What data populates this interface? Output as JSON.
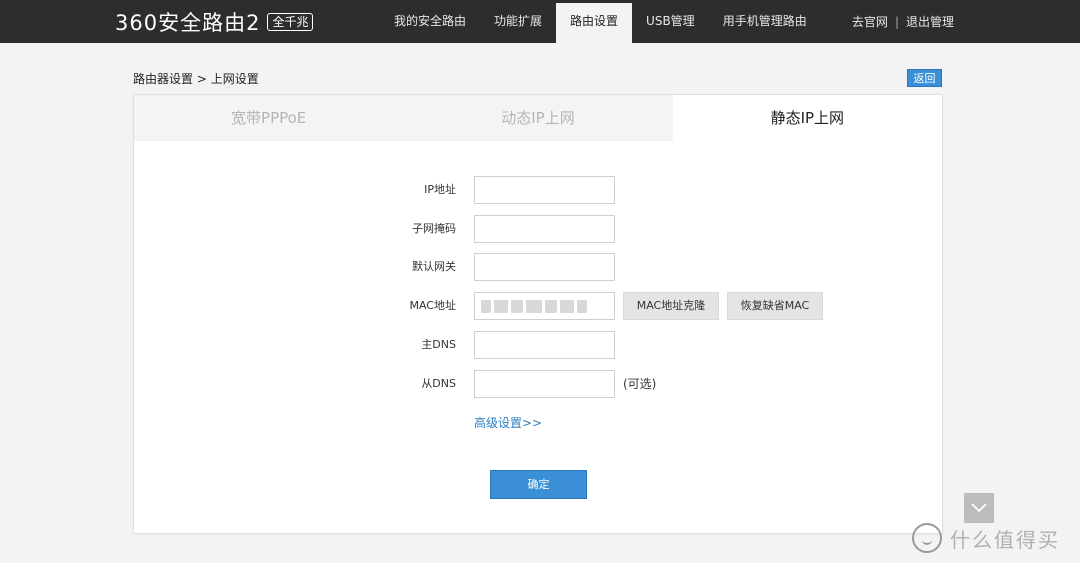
{
  "header": {
    "logo_text": "360安全路由2",
    "logo_badge": "全千兆",
    "nav": [
      {
        "label": "我的安全路由"
      },
      {
        "label": "功能扩展"
      },
      {
        "label": "路由设置"
      },
      {
        "label": "USB管理"
      },
      {
        "label": "用手机管理路由"
      }
    ],
    "active_nav": "路由设置",
    "links": {
      "official_site": "去官网",
      "logout": "退出管理"
    }
  },
  "breadcrumb": {
    "parent": "路由器设置",
    "separator": ">",
    "current": "上网设置"
  },
  "back_button": "返回",
  "tabs": [
    {
      "label": "宽带PPPoE"
    },
    {
      "label": "动态IP上网"
    },
    {
      "label": "静态IP上网"
    }
  ],
  "active_tab": "静态IP上网",
  "form": {
    "ip": {
      "label": "IP地址",
      "value": ""
    },
    "subnet": {
      "label": "子网掩码",
      "value": ""
    },
    "gateway": {
      "label": "默认网关",
      "value": ""
    },
    "mac": {
      "label": "MAC地址",
      "value": "",
      "clone_button": "MAC地址克隆",
      "restore_button": "恢复缺省MAC"
    },
    "dns1": {
      "label": "主DNS",
      "value": ""
    },
    "dns2": {
      "label": "从DNS",
      "value": "",
      "hint": "(可选)"
    },
    "advanced_link": "高级设置>>",
    "confirm_button": "确定"
  },
  "watermark": "什么值得买",
  "colors": {
    "topbar": "#2d2d2d",
    "accent": "#3a8fd6",
    "link": "#2f7fc1"
  }
}
